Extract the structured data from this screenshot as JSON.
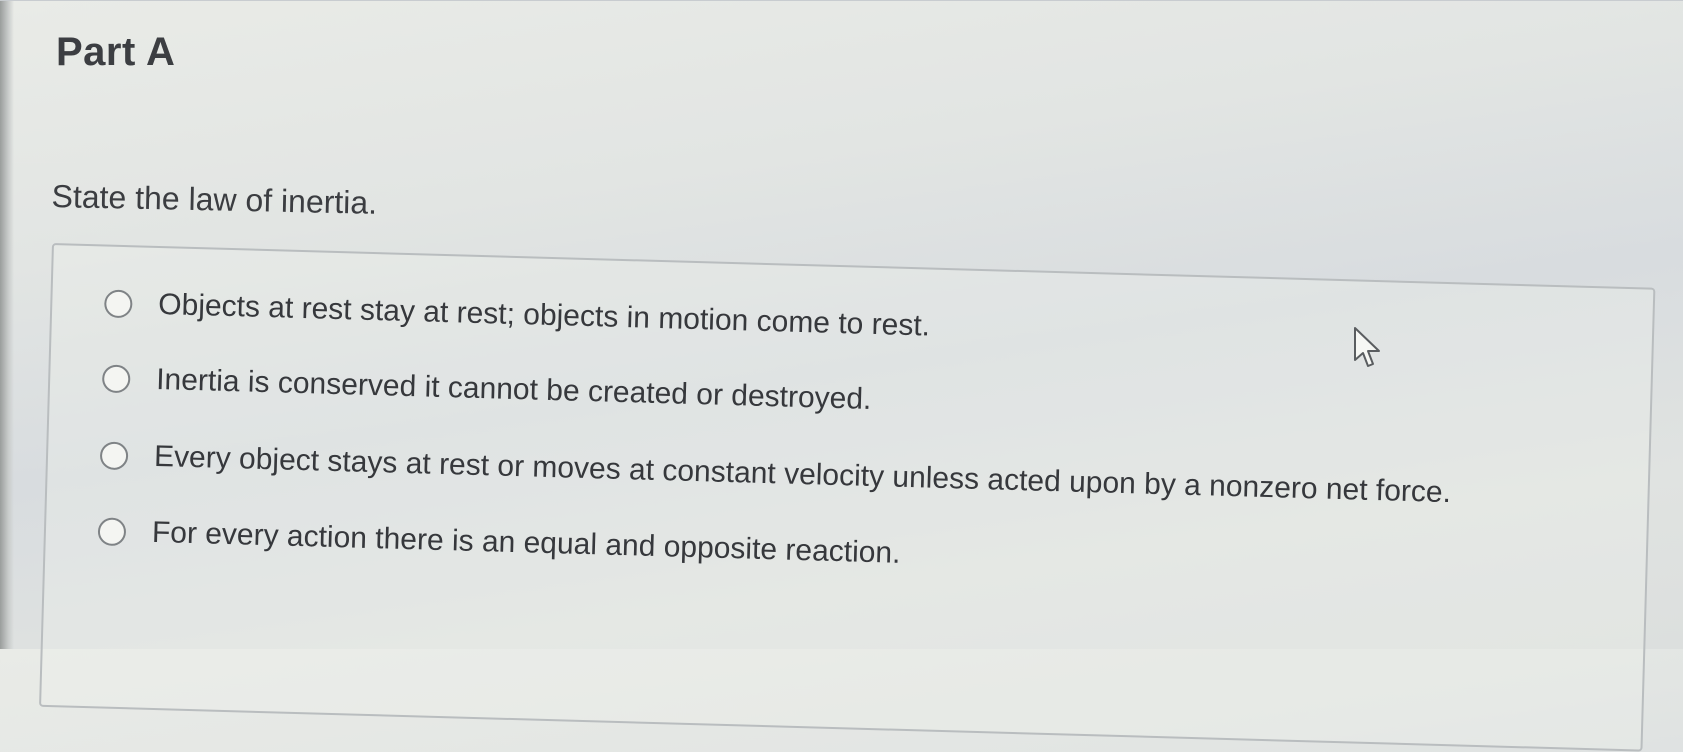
{
  "part": {
    "title": "Part A"
  },
  "question": {
    "prompt": "State the law of inertia."
  },
  "options": [
    {
      "label": "Objects at rest stay at rest; objects in motion come to rest.",
      "selected": false
    },
    {
      "label": "Inertia is conserved it cannot be created or destroyed.",
      "selected": false
    },
    {
      "label": "Every object stays at rest or moves at constant velocity unless acted upon by a nonzero net force.",
      "selected": false
    },
    {
      "label": "For every action there is an equal and opposite reaction.",
      "selected": false
    }
  ],
  "icons": {
    "radio": "radio-button-unchecked-icon",
    "cursor": "mouse-pointer-icon"
  }
}
